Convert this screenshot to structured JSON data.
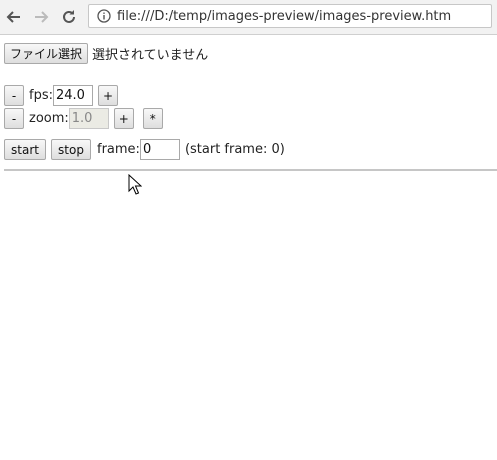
{
  "browser": {
    "back_icon": "arrow-left-icon",
    "forward_icon": "arrow-right-icon",
    "reload_icon": "reload-icon",
    "info_icon": "info-icon",
    "url": "file:///D:/temp/images-preview/images-preview.htm"
  },
  "file": {
    "choose_label": "ファイル選択",
    "status_text": "選択されていません"
  },
  "fps": {
    "minus_label": "-",
    "label": "fps:",
    "value": "24.0",
    "plus_label": "+"
  },
  "zoom": {
    "minus_label": "-",
    "label": "zoom:",
    "value": "1.0",
    "plus_label": "+",
    "star_label": "*"
  },
  "playback": {
    "start_label": "start",
    "stop_label": "stop",
    "frame_label": "frame:",
    "frame_value": "0",
    "start_frame_text": "(start frame: 0)"
  }
}
